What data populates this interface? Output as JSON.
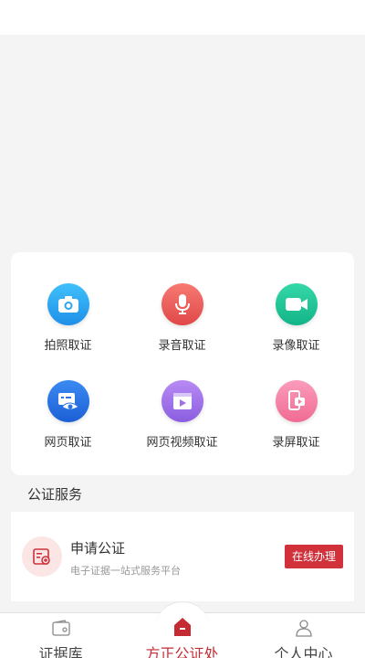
{
  "grid": [
    {
      "label": "拍照取证",
      "icon": "camera-icon",
      "color": "#2aa7f3"
    },
    {
      "label": "录音取证",
      "icon": "microphone-icon",
      "color": "#ee5b5b"
    },
    {
      "label": "录像取证",
      "icon": "video-camera-icon",
      "color": "#22c59a"
    },
    {
      "label": "网页取证",
      "icon": "webpage-eye-icon",
      "color": "#2c74e6"
    },
    {
      "label": "网页视频取证",
      "icon": "web-video-icon",
      "color": "#a070e8"
    },
    {
      "label": "录屏取证",
      "icon": "screen-record-icon",
      "color": "#f27aa0"
    }
  ],
  "section_title": "公证服务",
  "service": {
    "title": "申请公证",
    "desc": "电子证据一站式服务平台",
    "button": "在线办理",
    "accent": "#d0313a"
  },
  "tabs": [
    {
      "label": "证据库",
      "icon": "wallet-icon"
    },
    {
      "label": "方正公证处",
      "icon": "home-icon",
      "active": true
    },
    {
      "label": "个人中心",
      "icon": "user-icon"
    }
  ]
}
